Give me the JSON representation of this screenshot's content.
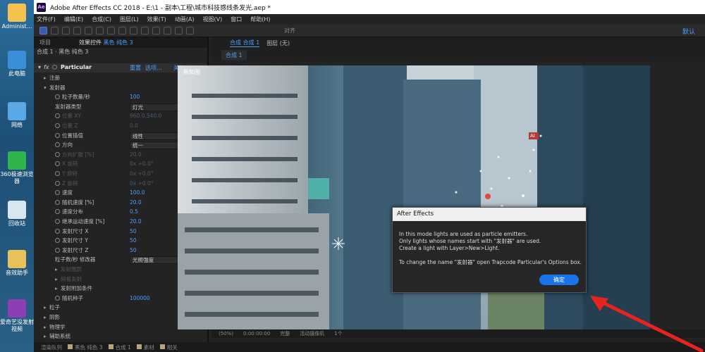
{
  "desktop": {
    "icons": [
      {
        "label": "Administ...",
        "name": "admin-user-icon",
        "color": "#f2c14e"
      },
      {
        "label": "此电脑",
        "name": "computer-icon",
        "color": "#3b8ed8"
      },
      {
        "label": "网络",
        "name": "network-icon",
        "color": "#5aa9e6"
      },
      {
        "label": "360极速浏览器",
        "name": "browser-360-icon",
        "color": "#2fb34a"
      },
      {
        "label": "回收站",
        "name": "recycle-bin-icon",
        "color": "#d8e6f0"
      },
      {
        "label": "音效助手",
        "name": "audio-assistant-icon",
        "color": "#e8c15a"
      },
      {
        "label": "爱奇艺没发射视频",
        "name": "iqiyi-icon",
        "color": "#8b3fb0"
      }
    ]
  },
  "titlebar": {
    "logo": "Ae",
    "title": "Adobe After Effects CC 2018 - E:\\1 - 副本\\工程\\城市科技感线条发光.aep *"
  },
  "menu": [
    "文件(F)",
    "编辑(E)",
    "合成(C)",
    "图层(L)",
    "效果(T)",
    "动画(A)",
    "视图(V)",
    "窗口",
    "帮助(H)"
  ],
  "toolbar": {
    "snap_label": "对齐",
    "default_label": "默认"
  },
  "effect_panel": {
    "tab_project": "项目",
    "tab_effects_prefix": "效果控件",
    "tab_effects_layer": "黑色 纯色 3",
    "breadcrumb": "合成 1 · 黑色 纯色 3",
    "fx": "fx",
    "effect_name": "Particular",
    "reset": "重置",
    "options": "选项...",
    "about": "关于...",
    "rows": [
      {
        "indent": 1,
        "tri": "▸",
        "label": "注册",
        "dim": false
      },
      {
        "indent": 1,
        "tri": "▾",
        "label": "发射器",
        "dim": false
      },
      {
        "indent": 2,
        "sw": true,
        "label": "粒子数量/秒",
        "value": "100",
        "dim": false
      },
      {
        "indent": 2,
        "label": "发射器类型",
        "dropdown": "灯光",
        "dim": false
      },
      {
        "indent": 2,
        "sw": true,
        "label": "位置 XY",
        "value": "960.0,540.0",
        "dim": true
      },
      {
        "indent": 2,
        "sw": true,
        "label": "位置 Z",
        "value": "0.0",
        "dim": true
      },
      {
        "indent": 2,
        "sw": true,
        "label": "位置插值",
        "dropdown": "线性",
        "dim": false
      },
      {
        "indent": 2,
        "sw": true,
        "label": "方向",
        "dropdown": "统一",
        "dim": false
      },
      {
        "indent": 2,
        "sw": true,
        "label": "方向扩散 [%]",
        "value": "20.0",
        "dim": true
      },
      {
        "indent": 2,
        "sw": true,
        "label": "X 旋转",
        "value": "0x +0.0°",
        "dim": true
      },
      {
        "indent": 2,
        "sw": true,
        "label": "Y 旋转",
        "value": "0x +0.0°",
        "dim": true
      },
      {
        "indent": 2,
        "sw": true,
        "label": "Z 旋转",
        "value": "0x +0.0°",
        "dim": true
      },
      {
        "indent": 2,
        "sw": true,
        "label": "速度",
        "value": "100.0",
        "dim": false
      },
      {
        "indent": 2,
        "sw": true,
        "label": "随机速度 [%]",
        "value": "20.0",
        "dim": false
      },
      {
        "indent": 2,
        "sw": true,
        "label": "速度分布",
        "value": "0.5",
        "dim": false
      },
      {
        "indent": 2,
        "sw": true,
        "label": "继承运动速度 [%]",
        "value": "20.0",
        "dim": false
      },
      {
        "indent": 2,
        "sw": true,
        "label": "发射尺寸 X",
        "value": "50",
        "dim": false
      },
      {
        "indent": 2,
        "sw": true,
        "label": "发射尺寸 Y",
        "value": "50",
        "dim": false
      },
      {
        "indent": 2,
        "sw": true,
        "label": "发射尺寸 Z",
        "value": "50",
        "dim": false
      },
      {
        "indent": 2,
        "label": "粒子数/秒 修改器",
        "dropdown": "光照强度",
        "dim": false
      },
      {
        "indent": 2,
        "tri": "▸",
        "label": "发射图层",
        "dim": true
      },
      {
        "indent": 2,
        "tri": "▸",
        "label": "网格发射",
        "dim": true
      },
      {
        "indent": 2,
        "tri": "▸",
        "label": "发射附加条件",
        "dim": false
      },
      {
        "indent": 2,
        "sw": true,
        "label": "随机种子",
        "value": "100000",
        "dim": false
      },
      {
        "indent": 1,
        "tri": "▸",
        "label": "粒子",
        "dim": false
      },
      {
        "indent": 1,
        "tri": "▸",
        "label": "阴影",
        "dim": false
      },
      {
        "indent": 1,
        "tri": "▸",
        "label": "物理学",
        "dim": false
      },
      {
        "indent": 1,
        "tri": "▸",
        "label": "辅助系统",
        "dim": false
      }
    ]
  },
  "composition": {
    "tab_comp_prefix": "合成",
    "tab_comp_name": "合成 1",
    "tab_layer": "图层 (无)",
    "subtab": "合成 1",
    "watermark": "新知图",
    "badge": "AI"
  },
  "viewer_bar": [
    "(50%)",
    "0:00:00:00",
    "完整",
    "活动摄像机",
    "1个"
  ],
  "bottom_tabs": [
    "渲染队列",
    "黑色 纯色 3",
    "合成 1",
    "素材",
    "相关"
  ],
  "dialog": {
    "title": "After Effects",
    "line1": "In this mode lights are used as particle emitters.",
    "line2": "Only lights whose names start with \"发射器\" are used.",
    "line3": "Create a light with Layer>New>Light.",
    "line4": "To change the name \"发射器\" open Trapcode Particular's Options box.",
    "ok": "确定"
  }
}
